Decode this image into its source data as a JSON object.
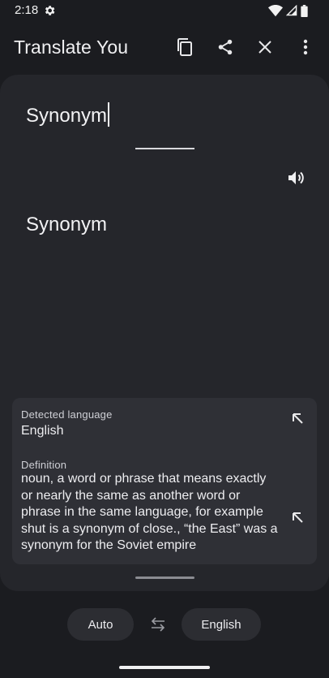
{
  "status_bar": {
    "time": "2:18",
    "icons": [
      "settings-gear-icon",
      "wifi-icon",
      "signal-icon",
      "battery-icon"
    ]
  },
  "app_bar": {
    "title": "Translate You",
    "actions": [
      "copy-icon",
      "share-icon",
      "close-icon",
      "more-vert-icon"
    ]
  },
  "translator": {
    "source_text": "Synonym",
    "result_text": "Synonym",
    "speaker_icon": "volume-icon"
  },
  "info_panel": {
    "detected_language_label": "Detected language",
    "detected_language_value": "English",
    "definition_label": "Definition",
    "definition_text": "noun, a word or phrase that means exactly or nearly the same as another word or phrase in the same language, for example shut is a synonym of close., “the East” was a synonym for the Soviet empire",
    "expand_icon": "arrow-up-left-icon"
  },
  "language_bar": {
    "source_language": "Auto",
    "target_language": "English",
    "swap_icon": "swap-arrows-icon"
  },
  "colors": {
    "background": "#1b1c20",
    "card": "#25262b",
    "panel": "#2f3036",
    "pill": "#2c2d32",
    "text": "#f2f2f4"
  }
}
